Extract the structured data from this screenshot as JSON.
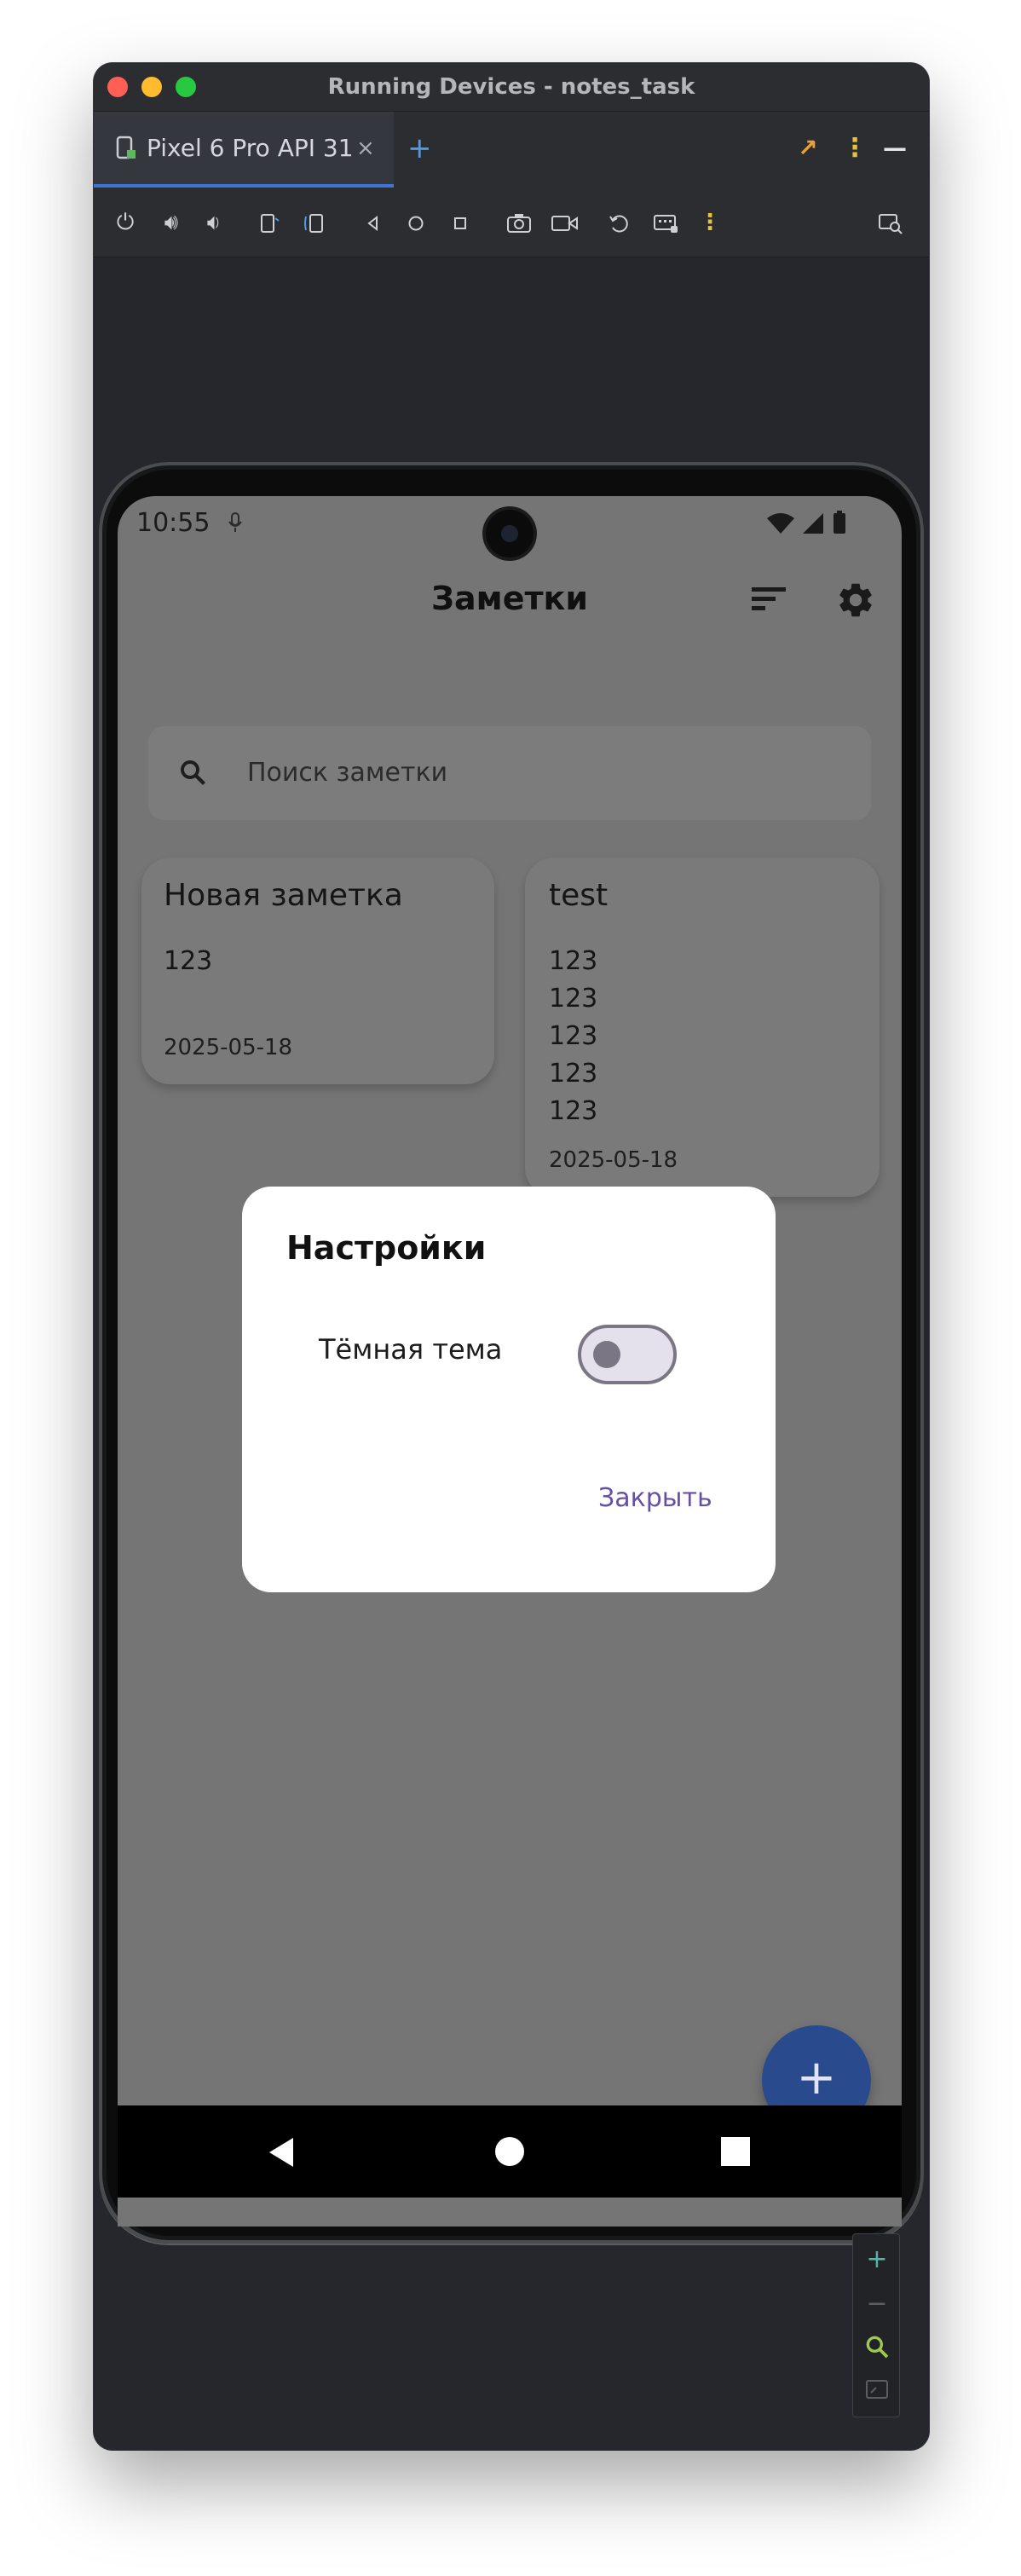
{
  "window": {
    "title": "Running Devices - notes_task"
  },
  "tabs": [
    {
      "label": "Pixel 6 Pro API 31",
      "close": "×"
    }
  ],
  "tab_actions": {
    "add": "+",
    "menu": "⋮",
    "minimize": "—",
    "move": "↗"
  },
  "device": {
    "status_bar": {
      "time": "10:55"
    },
    "app_bar": {
      "title": "Заметки"
    },
    "search": {
      "placeholder": "Поиск заметки"
    },
    "notes": [
      {
        "title": "Новая заметка",
        "lines": [
          "123"
        ],
        "date": "2025-05-18"
      },
      {
        "title": "test",
        "lines": [
          "123",
          "123",
          "123",
          "123",
          "123"
        ],
        "date": "2025-05-18"
      }
    ],
    "dialog": {
      "title": "Настройки",
      "toggle_label": "Тёмная тема",
      "toggle_on": false,
      "close_label": "Закрыть"
    },
    "fab": {
      "label": "+"
    }
  },
  "zoom_controls": {
    "zoom_in": "+",
    "zoom_out": "−"
  },
  "colors": {
    "ide_background": "#25272c",
    "tab_accent": "#3d75d9",
    "dialog_accent": "#6750a4",
    "fab": "#294b8d",
    "scrim_screen": "#757575"
  }
}
